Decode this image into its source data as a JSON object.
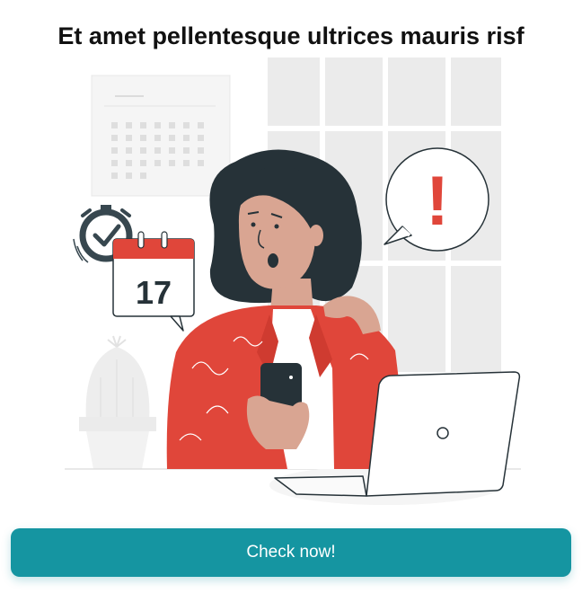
{
  "title": "Et amet pellentesque ultrices mauris risf",
  "illustration": {
    "calendar_day": "17",
    "alert_symbol": "!"
  },
  "cta": {
    "label": "Check now!"
  },
  "colors": {
    "accent": "#1595a1",
    "alert_red": "#e0463a",
    "hair": "#263238",
    "skin": "#d9a592",
    "jacket": "#e0463a"
  },
  "icons": [
    "stopwatch-icon",
    "calendar-icon",
    "speech-bubble-alert-icon",
    "phone-icon",
    "laptop-icon",
    "cactus-icon"
  ]
}
